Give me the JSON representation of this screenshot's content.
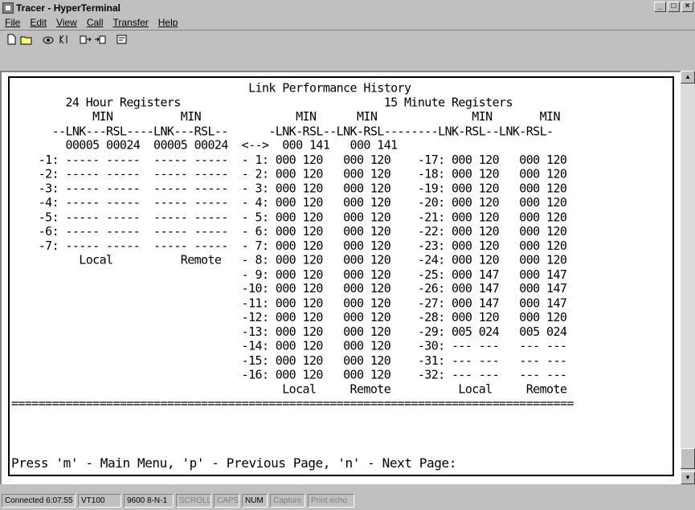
{
  "window": {
    "title": "Tracer - HyperTerminal",
    "min_glyph": "_",
    "max_glyph": "□",
    "close_glyph": "×"
  },
  "menu": [
    "File",
    "Edit",
    "View",
    "Call",
    "Transfer",
    "Help"
  ],
  "toolbar": {
    "icons": [
      "new-icon",
      "open-icon",
      "connect-icon",
      "disconnect-icon",
      "send-icon",
      "receive-icon",
      "properties-icon"
    ]
  },
  "terminal": {
    "lines": [
      "                                   Link Performance History",
      "        24 Hour Registers                              15 Minute Registers",
      "            MIN          MIN              MIN      MIN              MIN       MIN",
      "      --LNK---RSL----LNK---RSL--      -LNK-RSL--LNK-RSL--------LNK-RSL--LNK-RSL-",
      "        00005 00024  00005 00024  <-->  000 141   000 141",
      "    -1: ----- -----  ----- -----  - 1: 000 120   000 120    -17: 000 120   000 120",
      "    -2: ----- -----  ----- -----  - 2: 000 120   000 120    -18: 000 120   000 120",
      "    -3: ----- -----  ----- -----  - 3: 000 120   000 120    -19: 000 120   000 120",
      "    -4: ----- -----  ----- -----  - 4: 000 120   000 120    -20: 000 120   000 120",
      "    -5: ----- -----  ----- -----  - 5: 000 120   000 120    -21: 000 120   000 120",
      "    -6: ----- -----  ----- -----  - 6: 000 120   000 120    -22: 000 120   000 120",
      "    -7: ----- -----  ----- -----  - 7: 000 120   000 120    -23: 000 120   000 120",
      "          Local          Remote   - 8: 000 120   000 120    -24: 000 120   000 120",
      "                                  - 9: 000 120   000 120    -25: 000 147   000 147",
      "                                  -10: 000 120   000 120    -26: 000 147   000 147",
      "                                  -11: 000 120   000 120    -27: 000 147   000 147",
      "                                  -12: 000 120   000 120    -28: 000 120   000 120",
      "                                  -13: 000 120   000 120    -29: 005 024   005 024",
      "                                  -14: 000 120   000 120    -30: --- ---   --- ---",
      "                                  -15: 000 120   000 120    -31: --- ---   --- ---",
      "                                  -16: 000 120   000 120    -32: --- ---   --- ---",
      "                                        Local     Remote          Local     Remote",
      "==================================================================================="
    ],
    "prompt": "Press 'm' - Main Menu, 'p' - Previous Page, 'n' - Next Page:"
  },
  "statusbar": {
    "connected": "Connected 6:07:55",
    "emulation": "VT100",
    "settings": "9600 8-N-1",
    "scroll": "SCROLL",
    "caps": "CAPS",
    "num": "NUM",
    "capture": "Capture",
    "print_echo": "Print echo"
  }
}
